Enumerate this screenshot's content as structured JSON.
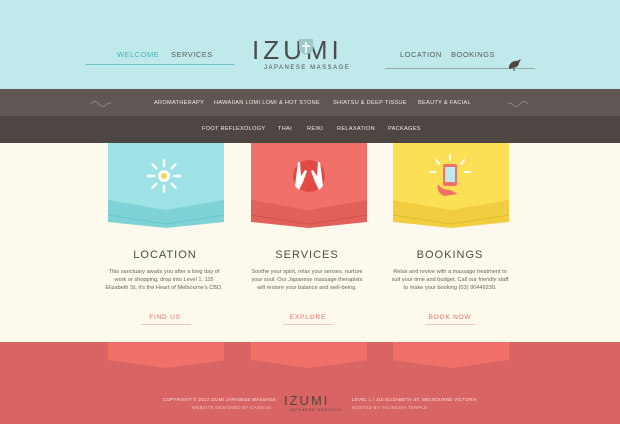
{
  "header": {
    "nav_left": [
      "WELCOME",
      "SERVICES"
    ],
    "nav_right": [
      "LOCATION",
      "BOOKINGS"
    ],
    "logo": "IZUMI",
    "logo_sub": "JAPANESE MASSAGE"
  },
  "submenu": {
    "row1": [
      "AROMATHERAPY",
      "HAWAIIAN LOMI LOMI & HOT STONE",
      "SHIATSU & DEEP TISSUE",
      "BEAUTY & FACIAL"
    ],
    "row2": [
      "FOOT REFLEXOLOGY",
      "THAI",
      "REIKI",
      "RELAXATION",
      "PACKAGES"
    ]
  },
  "cards": [
    {
      "title": "LOCATION",
      "body": "This sanctuary awaits you after a long day of work or shopping, drop into Level 1, 115 Elizabeth St, it's the Heart of Melbourne's CBD.",
      "link": "FIND US",
      "color": "#9fe2e6",
      "icon": "sun-icon"
    },
    {
      "title": "SERVICES",
      "body": "Soothe your spirit, relax your senses, nurture your soul. Our Japanese massage therapists will restore your balance and well-being.",
      "link": "EXPLORE",
      "color": "#f1716a",
      "icon": "hands-icon"
    },
    {
      "title": "BOOKINGS",
      "body": "Relax and revive with a massage treatment to suit your time and budget. Call our friendly staff to make your booking (03) 90449230.",
      "link": "BOOK NOW",
      "color": "#fbdf55",
      "icon": "phone-icon"
    }
  ],
  "footer": {
    "copyright": "COPYRIGHT © 2013 IZUMI JAPANESE MASSAGE",
    "designed_by": "WEBSITE DESIGNED BY CASSIUS",
    "address": "LEVEL 1 / 115 ELIZABETH ST, MELBOURNE VICTORIA",
    "hosted_by": "HOSTED BY VALINEDIA TEMPLE",
    "logo": "IZUMI",
    "logo_sub": "JAPANESE MASSAGE"
  },
  "colors": {
    "teal": "#bfe9ea",
    "brown": "#605653",
    "coral": "#d86563",
    "cream": "#fdf9ec"
  }
}
